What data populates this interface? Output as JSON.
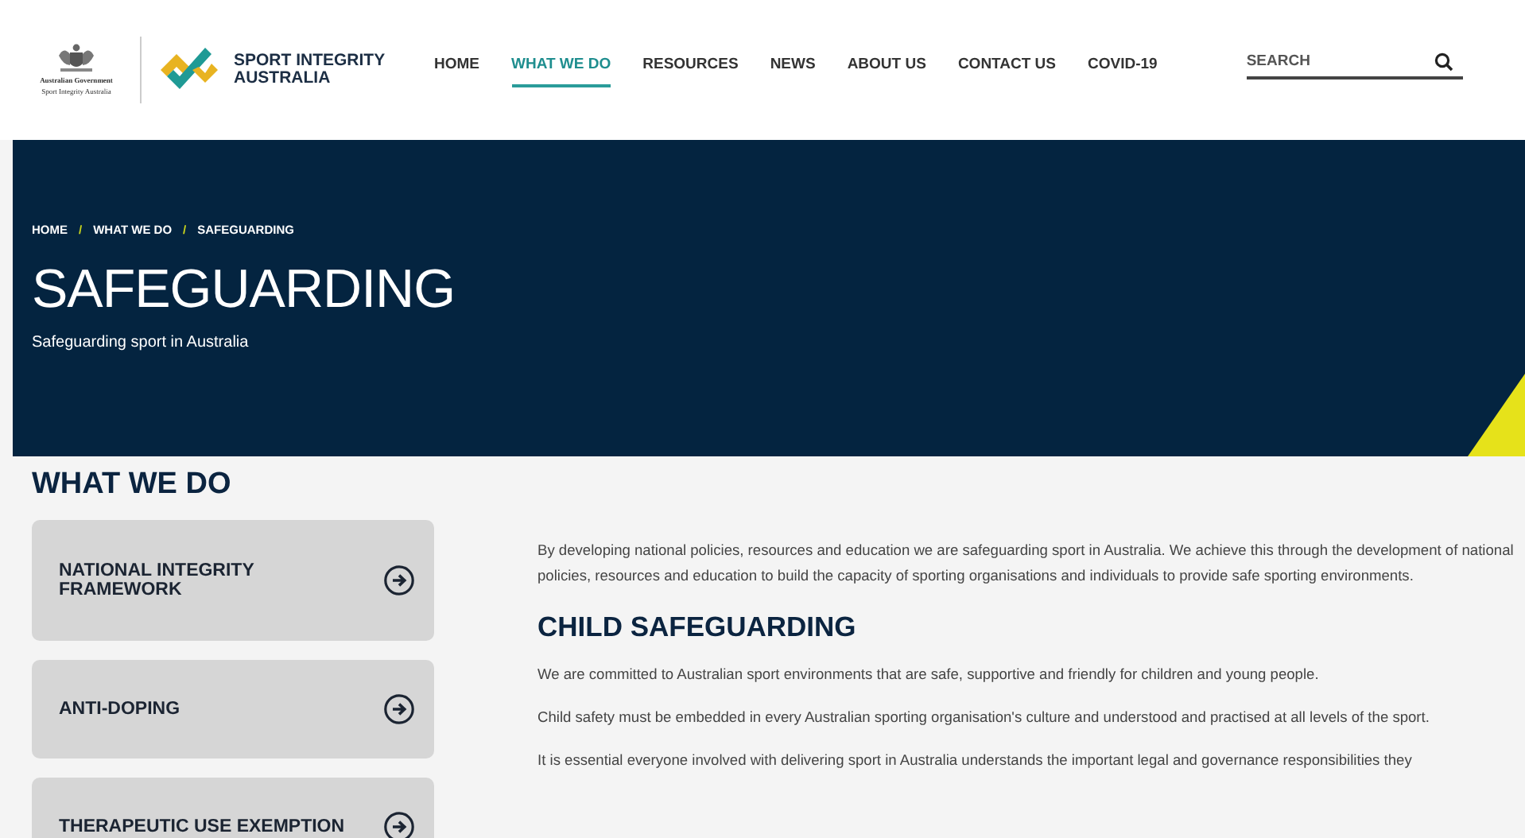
{
  "header": {
    "gov_lines": [
      "Australian Government",
      "Sport Integrity Australia"
    ],
    "brand": [
      "SPORT INTEGRITY",
      "AUSTRALIA"
    ]
  },
  "nav": [
    {
      "label": "HOME",
      "selected": false
    },
    {
      "label": "WHAT WE DO",
      "selected": true
    },
    {
      "label": "RESOURCES",
      "selected": false
    },
    {
      "label": "NEWS",
      "selected": false
    },
    {
      "label": "ABOUT US",
      "selected": false
    },
    {
      "label": "CONTACT US",
      "selected": false
    },
    {
      "label": "COVID-19",
      "selected": false
    }
  ],
  "search": {
    "placeholder": "SEARCH"
  },
  "hero": {
    "breadcrumb": [
      {
        "kind": "link",
        "text": "HOME"
      },
      {
        "kind": "separator",
        "text": "/"
      },
      {
        "kind": "link",
        "text": "WHAT WE DO"
      },
      {
        "kind": "separator",
        "text": "/"
      },
      {
        "kind": "current",
        "text": "SAFEGUARDING"
      }
    ],
    "title": "SAFEGUARDING",
    "subtitle": "Safeguarding sport in Australia"
  },
  "sidebar": {
    "title": "WHAT WE DO",
    "items": [
      {
        "label": "NATIONAL INTEGRITY FRAMEWORK"
      },
      {
        "label": "ANTI-DOPING"
      },
      {
        "label": "THERAPEUTIC USE EXEMPTION"
      }
    ]
  },
  "content": [
    {
      "kind": "paragraph",
      "text": "By developing national policies, resources and education we are safeguarding sport in Australia. We achieve this through the development of national policies, resources and education to build the capacity of sporting organisations and individuals to provide safe sporting environments."
    },
    {
      "kind": "heading",
      "text": "CHILD SAFEGUARDING"
    },
    {
      "kind": "paragraph",
      "text": "We are committed to Australian sport environments that are safe, supportive and friendly for children and young people."
    },
    {
      "kind": "paragraph",
      "text": "Child safety must be embedded in every Australian sporting organisation's culture and understood and practised at all levels of the sport."
    },
    {
      "kind": "paragraph",
      "text": "It is essential everyone involved with delivering sport in Australia understands the important legal and governance responsibilities they"
    }
  ]
}
